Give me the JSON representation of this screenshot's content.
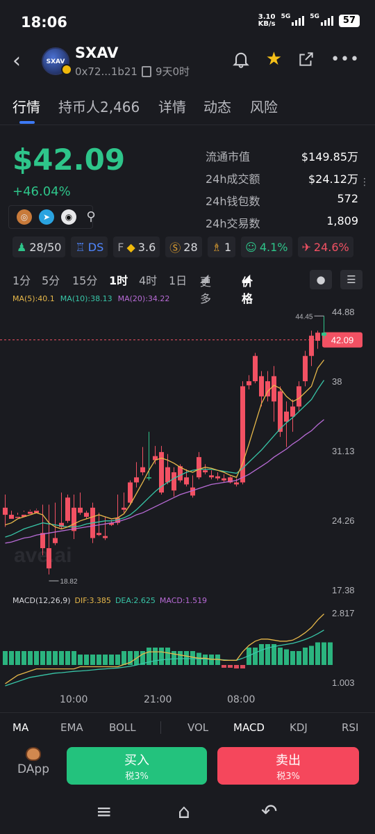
{
  "status": {
    "time": "18:06",
    "speed": "3.10",
    "speed_unit": "KB/s",
    "net1": "5G",
    "net2": "5G",
    "battery": "57"
  },
  "header": {
    "symbol": "SXAV",
    "address": "0x72...1b21",
    "age": "9天0时",
    "logo_text": "SXAV"
  },
  "tabs": [
    "行情",
    "持币人2,466",
    "详情",
    "动态",
    "风险"
  ],
  "price": "$42.09",
  "change": "+46.04%",
  "stats": [
    {
      "k": "流通市值",
      "v": "$149.85万"
    },
    {
      "k": "24h成交额",
      "v": "$24.12万"
    },
    {
      "k": "24h钱包数",
      "v": "572"
    },
    {
      "k": "24h交易数",
      "v": "1,809"
    }
  ],
  "chips": {
    "holders": "28/50",
    "ds": "DS",
    "f_label": "F",
    "f_val": "3.6",
    "bag": "28",
    "trophy": "1",
    "face_pct": "4.1%",
    "rocket_pct": "24.6%"
  },
  "intervals": [
    "1分",
    "5分",
    "15分",
    "1时",
    "4时",
    "1日",
    "更多",
    "价格"
  ],
  "ma_legend": {
    "ma5": "MA(5):40.1",
    "ma10": "MA(10):38.13",
    "ma20": "MA(20):34.22"
  },
  "macd_legend": {
    "name": "MACD(12,26,9)",
    "dif": "DIF:3.385",
    "dea": "DEA:2.625",
    "macd": "MACD:1.519"
  },
  "time_labels": [
    "10:00",
    "21:00",
    "08:00"
  ],
  "indicators": [
    "MA",
    "EMA",
    "BOLL",
    "VOL",
    "MACD",
    "KDJ",
    "RSI"
  ],
  "footer": {
    "dapp": "DApp",
    "buy": "买入",
    "buy_tax": "税3%",
    "sell": "卖出",
    "sell_tax": "税3%"
  },
  "colors": {
    "up": "#2ec58a",
    "down": "#f25163",
    "ma5": "#e7b84a",
    "ma10": "#38c6a8",
    "ma20": "#b86bd6"
  },
  "chart_data": {
    "type": "candlestick",
    "y_ticks": [
      "44.88",
      "38",
      "31.13",
      "24.26",
      "17.38"
    ],
    "current_price": "42.09",
    "high_label": "44.45",
    "low_label": "18.82",
    "ylim": [
      17.38,
      44.88
    ],
    "candles": [
      [
        25.5,
        26.8,
        24.8,
        23.6
      ],
      [
        24.8,
        25.2,
        24.4,
        24.6
      ],
      [
        24.6,
        25.0,
        24.5,
        24.8
      ],
      [
        24.8,
        25.2,
        24.6,
        25.1
      ],
      [
        25.1,
        25.3,
        24.9,
        25.2
      ],
      [
        25.2,
        25.4,
        25.0,
        25.3
      ],
      [
        23.0,
        25.8,
        21.5,
        20.8
      ],
      [
        21.5,
        25.8,
        19.5,
        18.9
      ],
      [
        22.5,
        26.0,
        22.0,
        21.8
      ],
      [
        24.0,
        27.0,
        23.6,
        23.4
      ],
      [
        26.5,
        26.8,
        24.2,
        24.0
      ],
      [
        25.5,
        26.8,
        23.2,
        22.4
      ],
      [
        25.5,
        27.0,
        25.0,
        24.8
      ],
      [
        25.0,
        25.2,
        24.6,
        24.4
      ],
      [
        25.5,
        26.0,
        22.5,
        22.0
      ],
      [
        23.0,
        25.0,
        22.8,
        22.7
      ],
      [
        22.7,
        24.6,
        22.5,
        22.3
      ],
      [
        24.0,
        24.3,
        23.8,
        23.7
      ],
      [
        24.5,
        26.8,
        24.0,
        23.8
      ],
      [
        25.5,
        27.0,
        25.3,
        25.0
      ],
      [
        28.0,
        28.2,
        26.0,
        25.8
      ],
      [
        28.5,
        30.0,
        28.0,
        27.5
      ],
      [
        29.5,
        31.5,
        29.0,
        28.7
      ],
      [
        28.5,
        33.0,
        28.5,
        28.2
      ],
      [
        30.6,
        31.6,
        30.2,
        29.8
      ],
      [
        31.0,
        31.6,
        27.0,
        26.8
      ],
      [
        29.5,
        30.8,
        28.0,
        27.8
      ],
      [
        29.0,
        29.5,
        27.2,
        26.6
      ],
      [
        29.6,
        29.8,
        28.2,
        28.0
      ],
      [
        28.5,
        29.3,
        27.8,
        27.6
      ],
      [
        27.5,
        28.7,
        26.7,
        26.5
      ],
      [
        30.5,
        31.0,
        28.5,
        28.3
      ],
      [
        29.2,
        29.8,
        29.0,
        28.8
      ],
      [
        28.7,
        29.2,
        28.5,
        28.3
      ],
      [
        28.6,
        29.0,
        28.4,
        28.2
      ],
      [
        28.4,
        28.8,
        28.2,
        28.0
      ],
      [
        28.5,
        28.6,
        28.0,
        27.9
      ],
      [
        28.0,
        28.4,
        27.8,
        27.6
      ],
      [
        37.5,
        38.0,
        28.0,
        27.8
      ],
      [
        38.0,
        38.6,
        37.6,
        37.2
      ],
      [
        40.5,
        40.8,
        38.0,
        37.8
      ],
      [
        38.5,
        39.0,
        36.5,
        35.5
      ],
      [
        38.0,
        39.0,
        36.5,
        36.0
      ],
      [
        38.5,
        39.5,
        36.0,
        34.0
      ],
      [
        37.0,
        37.5,
        33.0,
        32.5
      ],
      [
        35.0,
        36.0,
        34.0,
        31.5
      ],
      [
        35.5,
        36.2,
        34.5,
        33.0
      ],
      [
        37.5,
        38.0,
        35.5,
        35.0
      ],
      [
        40.5,
        41.0,
        38.0,
        37.5
      ],
      [
        42.5,
        43.0,
        40.5,
        39.5
      ],
      [
        42.8,
        43.0,
        42.0,
        41.2
      ],
      [
        42.5,
        44.45,
        42.8,
        42.2
      ]
    ],
    "ma5": [
      23.8,
      24.0,
      24.4,
      24.6,
      24.8,
      25.0,
      24.8,
      24.0,
      23.6,
      23.4,
      23.6,
      23.9,
      24.2,
      24.4,
      24.6,
      24.8,
      24.6,
      24.4,
      24.5,
      24.9,
      25.8,
      26.9,
      28.0,
      29.2,
      30.2,
      30.4,
      30.2,
      29.9,
      29.5,
      29.2,
      29.0,
      29.3,
      29.5,
      29.4,
      29.2,
      29.0,
      28.7,
      28.5,
      29.9,
      31.8,
      33.8,
      35.8,
      37.0,
      37.6,
      37.3,
      36.5,
      36.0,
      36.3,
      36.9,
      37.5,
      39.3,
      40.1
    ],
    "ma10": [
      22.6,
      22.8,
      23.1,
      23.4,
      23.6,
      23.8,
      24.0,
      23.9,
      23.8,
      23.7,
      23.6,
      23.6,
      23.7,
      23.9,
      24.0,
      24.1,
      24.2,
      24.2,
      24.3,
      24.5,
      24.8,
      25.3,
      25.9,
      26.5,
      27.1,
      27.6,
      28.0,
      28.4,
      28.7,
      29.0,
      29.2,
      29.3,
      29.3,
      29.3,
      29.2,
      29.1,
      29.0,
      28.9,
      29.4,
      30.0,
      30.6,
      31.2,
      31.9,
      32.6,
      33.3,
      33.9,
      34.4,
      35.0,
      35.6,
      36.2,
      37.2,
      38.1
    ],
    "ma20": [
      22.0,
      22.1,
      22.3,
      22.5,
      22.6,
      22.8,
      22.9,
      23.0,
      23.1,
      23.2,
      23.3,
      23.4,
      23.5,
      23.6,
      23.7,
      23.8,
      23.9,
      24.0,
      24.1,
      24.3,
      24.5,
      24.8,
      25.0,
      25.3,
      25.6,
      25.9,
      26.2,
      26.5,
      26.8,
      27.0,
      27.2,
      27.4,
      27.6,
      27.8,
      27.9,
      28.0,
      28.1,
      28.2,
      28.5,
      28.8,
      29.2,
      29.6,
      30.0,
      30.5,
      30.9,
      31.3,
      31.8,
      32.2,
      32.7,
      33.1,
      33.7,
      34.2
    ],
    "macd_ticks": [
      "2.817",
      "1.003"
    ],
    "macd_hist": [
      0.8,
      0.8,
      0.8,
      0.8,
      0.8,
      0.8,
      0.8,
      0.8,
      0.8,
      0.8,
      0.8,
      0.8,
      0.6,
      0.6,
      0.6,
      0.6,
      0.6,
      0.6,
      0.6,
      0.8,
      0.8,
      0.8,
      0.8,
      1.0,
      1.0,
      1.0,
      1.0,
      0.8,
      0.8,
      0.8,
      0.8,
      0.7,
      0.6,
      0.6,
      0.6,
      0.4,
      0.4,
      0.5,
      0.5,
      1.0,
      1.0,
      1.2,
      1.2,
      1.2,
      1.0,
      0.9,
      0.8,
      0.8,
      1.0,
      1.1,
      1.3,
      1.3,
      1.3
    ],
    "macd_hist_sign": [
      1,
      1,
      1,
      1,
      1,
      1,
      1,
      1,
      1,
      1,
      1,
      1,
      1,
      1,
      1,
      1,
      1,
      1,
      1,
      1,
      1,
      1,
      1,
      1,
      1,
      1,
      1,
      1,
      1,
      1,
      1,
      1,
      1,
      1,
      1,
      -1,
      -1,
      -1,
      -1,
      1,
      1,
      1,
      1,
      1,
      1,
      1,
      1,
      1,
      1,
      1,
      1,
      1,
      1
    ],
    "dif": [
      0.1,
      0.3,
      0.5,
      0.6,
      0.7,
      0.8,
      0.8,
      0.8,
      0.8,
      0.8,
      0.8,
      0.8,
      0.9,
      0.9,
      0.9,
      0.9,
      0.9,
      0.9,
      0.9,
      1.0,
      1.1,
      1.3,
      1.5,
      1.6,
      1.6,
      1.6,
      1.55,
      1.5,
      1.45,
      1.4,
      1.35,
      1.3,
      1.3,
      1.25,
      1.25,
      1.2,
      1.2,
      1.2,
      1.6,
      1.9,
      2.1,
      2.2,
      2.2,
      2.15,
      2.1,
      2.1,
      2.15,
      2.3,
      2.5,
      2.75,
      3.1,
      3.385
    ],
    "dea": [
      0.0,
      0.1,
      0.2,
      0.3,
      0.4,
      0.45,
      0.5,
      0.55,
      0.6,
      0.62,
      0.65,
      0.68,
      0.7,
      0.72,
      0.75,
      0.78,
      0.8,
      0.82,
      0.84,
      0.88,
      0.92,
      0.98,
      1.05,
      1.12,
      1.18,
      1.22,
      1.25,
      1.27,
      1.28,
      1.28,
      1.28,
      1.27,
      1.26,
      1.25,
      1.24,
      1.22,
      1.2,
      1.2,
      1.3,
      1.42,
      1.55,
      1.68,
      1.78,
      1.85,
      1.9,
      1.95,
      2.0,
      2.08,
      2.18,
      2.3,
      2.45,
      2.625
    ]
  }
}
